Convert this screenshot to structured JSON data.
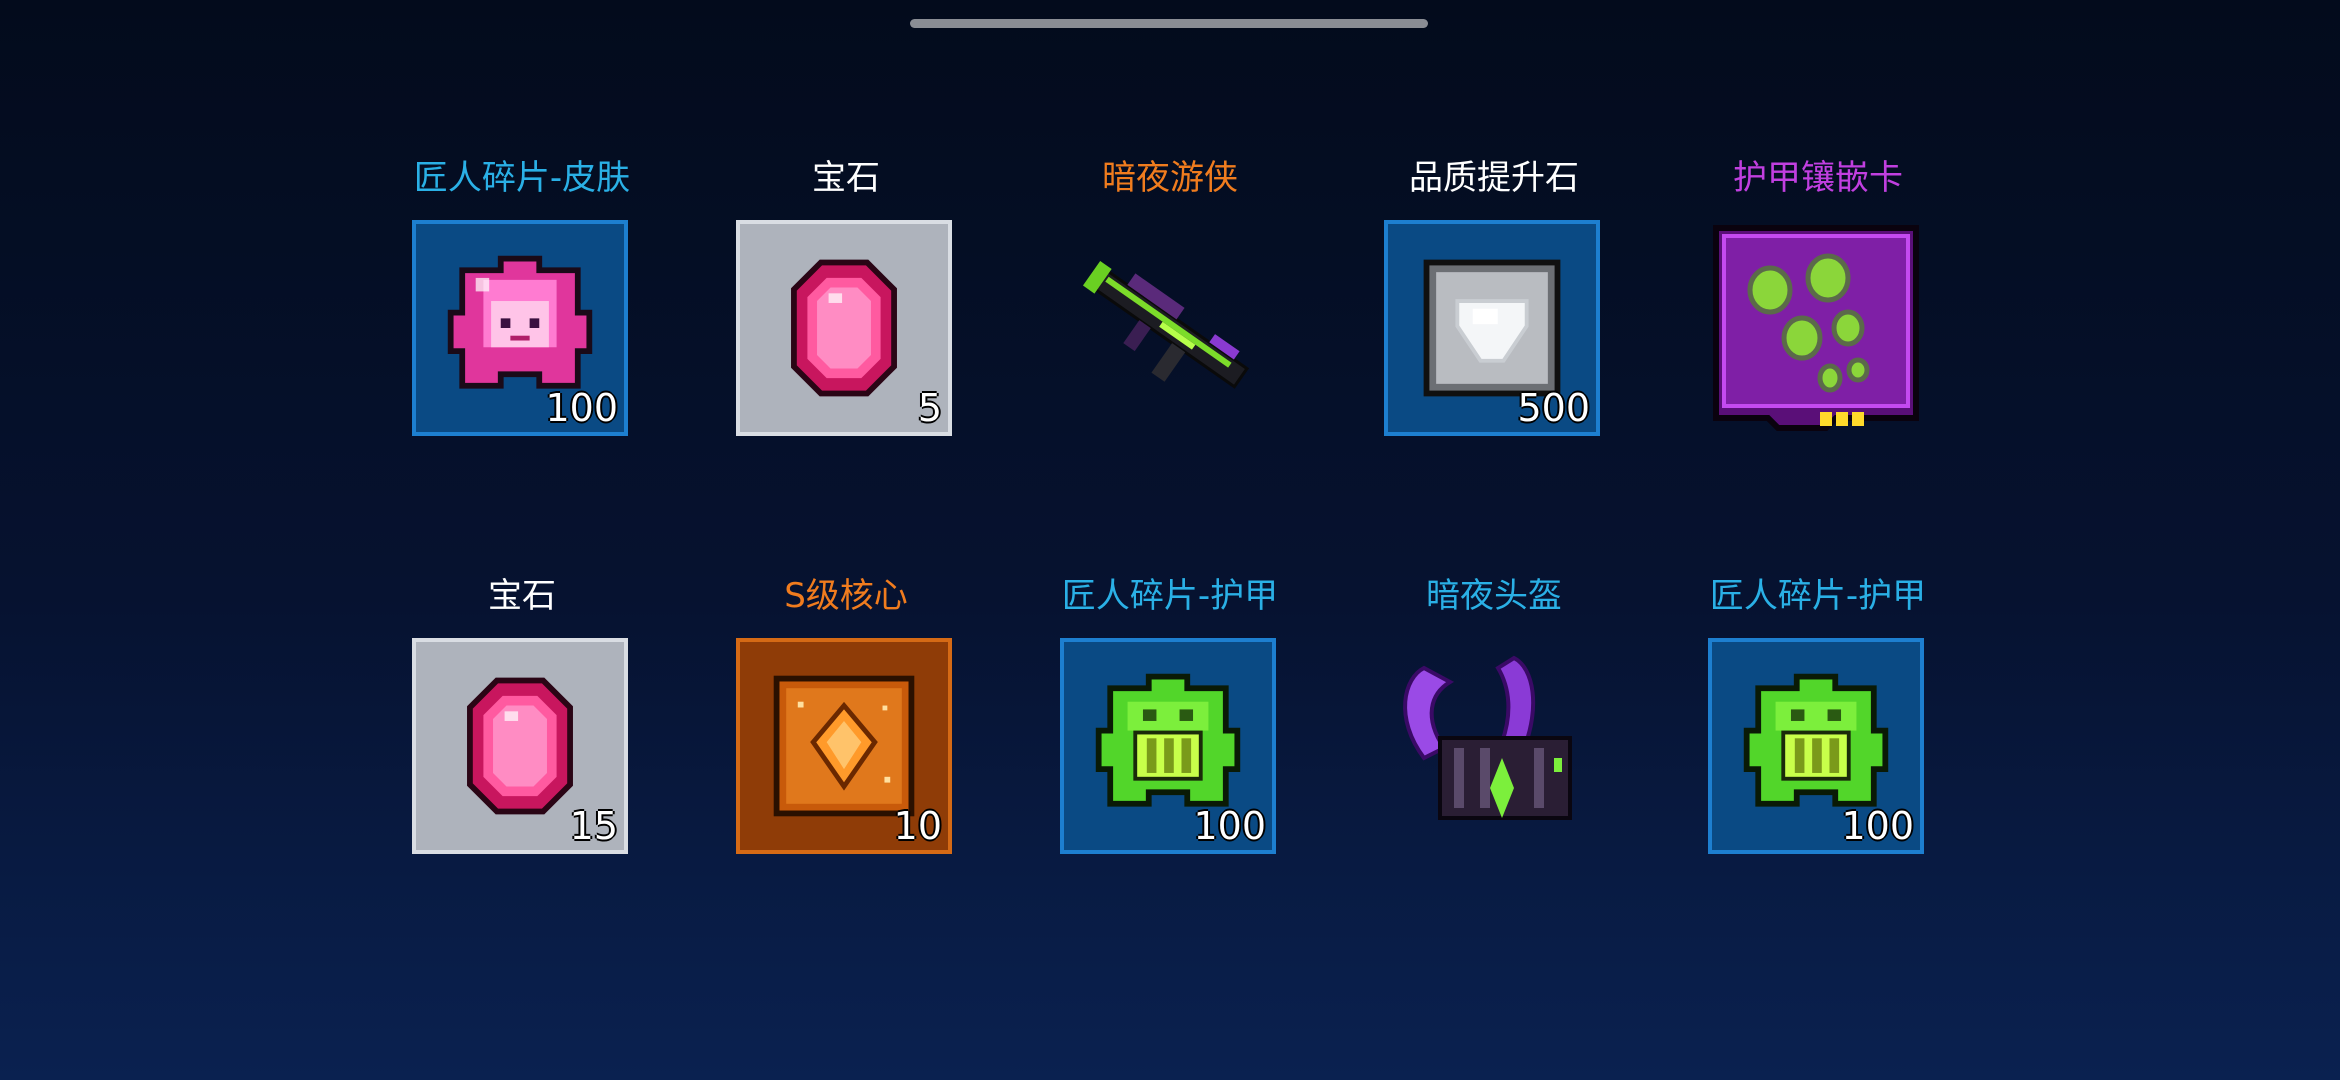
{
  "rows": [
    [
      {
        "name": "匠人碎片-皮肤",
        "count": "100",
        "name_color": "#2ab0e6",
        "frame": "blue",
        "icon": "skin-fragment-puzzle-icon"
      },
      {
        "name": "宝石",
        "count": "5",
        "name_color": "#ffffff",
        "frame": "gray",
        "icon": "pink-gem-icon"
      },
      {
        "name": "暗夜游侠",
        "count": "",
        "name_color": "#f07c1e",
        "frame": "none",
        "icon": "dark-rifle-icon"
      },
      {
        "name": "品质提升石",
        "count": "500",
        "name_color": "#ffffff",
        "frame": "blue",
        "icon": "white-upgrade-stone-icon"
      },
      {
        "name": "护甲镶嵌卡",
        "count": "",
        "name_color": "#c13fe0",
        "frame": "none",
        "icon": "armor-inlay-card-icon"
      }
    ],
    [
      {
        "name": "宝石",
        "count": "15",
        "name_color": "#ffffff",
        "frame": "gray",
        "icon": "pink-gem-icon"
      },
      {
        "name": "S级核心",
        "count": "10",
        "name_color": "#f07c1e",
        "frame": "orange",
        "icon": "s-core-icon"
      },
      {
        "name": "匠人碎片-护甲",
        "count": "100",
        "name_color": "#2ab0e6",
        "frame": "blue",
        "icon": "armor-fragment-puzzle-icon"
      },
      {
        "name": "暗夜头盔",
        "count": "",
        "name_color": "#2ab0e6",
        "frame": "none",
        "icon": "dark-helmet-icon"
      },
      {
        "name": "匠人碎片-护甲",
        "count": "100",
        "name_color": "#2ab0e6",
        "frame": "blue",
        "icon": "armor-fragment-puzzle-icon"
      }
    ]
  ],
  "colors": {
    "background_top": "#030b1c",
    "background_bottom": "#0a2150",
    "frame_blue": "#0a4a84",
    "frame_gray": "#aeb3bc",
    "frame_orange": "#8f3c07"
  }
}
